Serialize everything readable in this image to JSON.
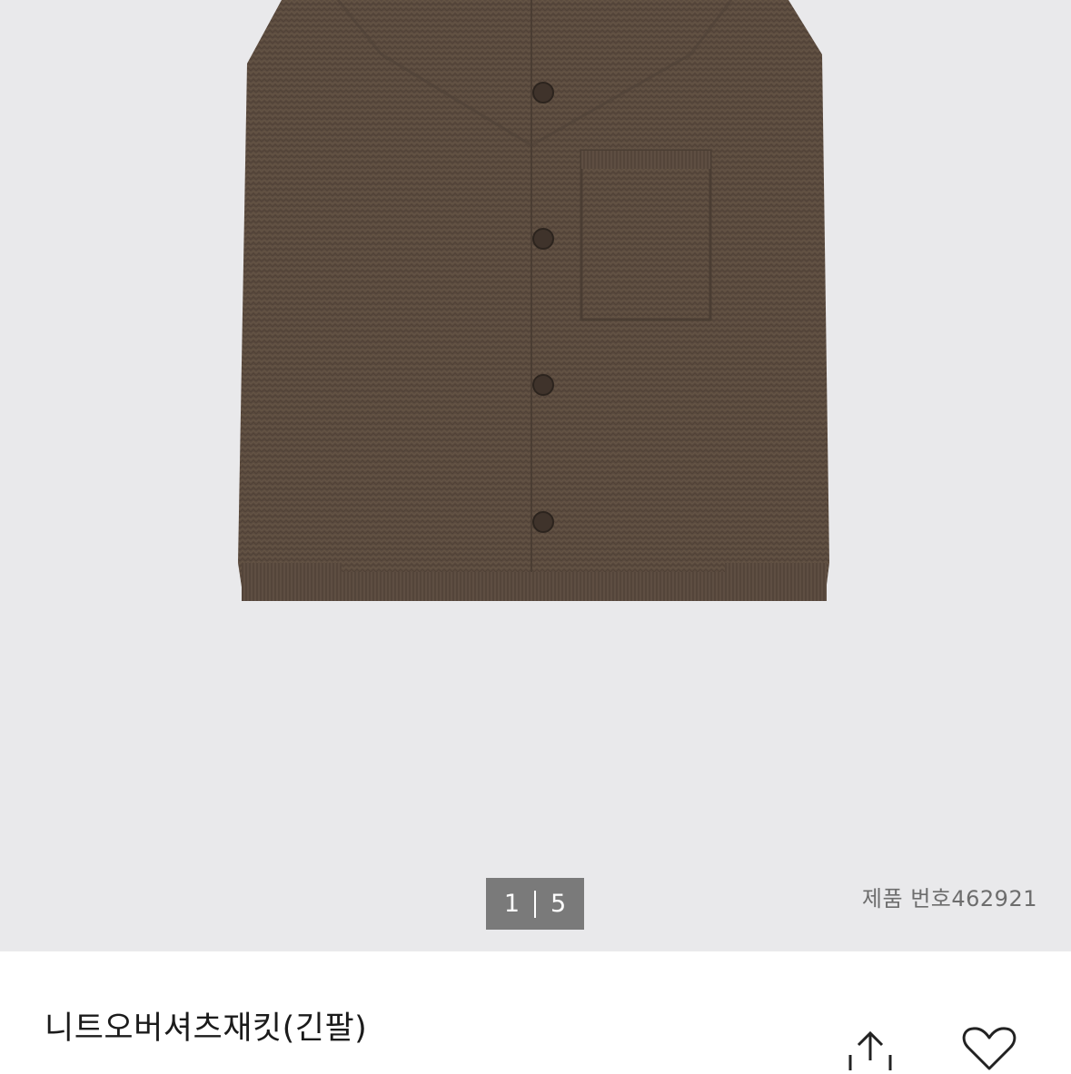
{
  "gallery": {
    "current_page": "1",
    "total_pages": "5",
    "product_number_label": "제품 번호",
    "product_number": "462921"
  },
  "product": {
    "title": "니트오버셔츠재킷(긴팔)",
    "garment_color": "#5a4a3e"
  },
  "actions": {
    "share_icon": "share-icon",
    "wishlist_icon": "heart-icon"
  }
}
